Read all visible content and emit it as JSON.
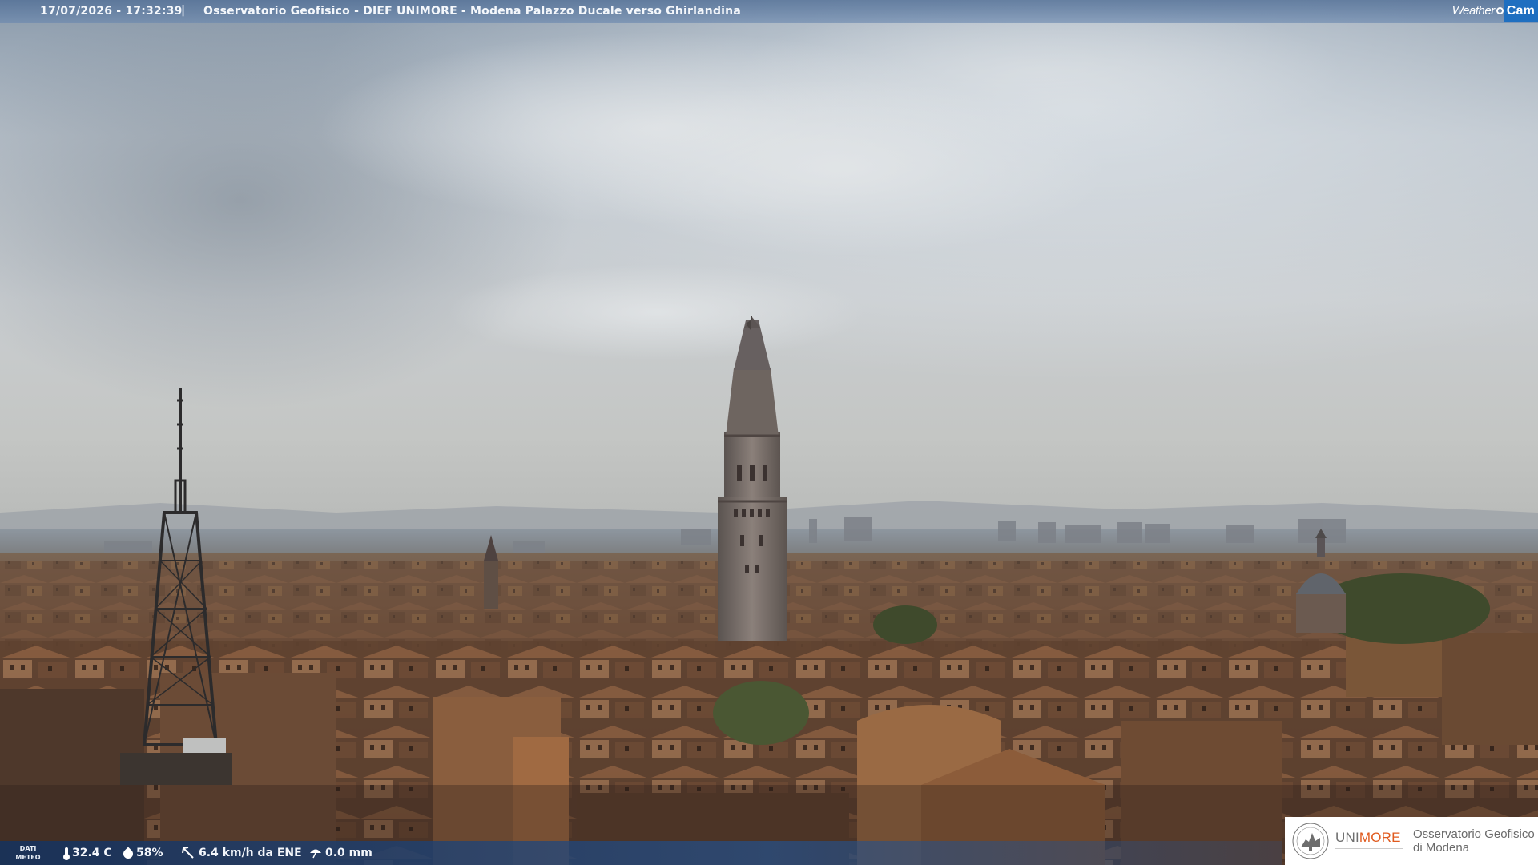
{
  "header": {
    "timestamp": "17/07/2026 - 17:32:39",
    "separator": "|",
    "title": "Osservatorio Geofisico - DIEF UNIMORE - Modena Palazzo Ducale verso Ghirlandina",
    "brand_weather": "Weather",
    "brand_cam": "Cam"
  },
  "weather": {
    "label_line1": "DATI",
    "label_line2": "METEO",
    "temperature": "32.4 C",
    "humidity": "58%",
    "wind": "6.4 km/h da ENE",
    "rain": "0.0 mm"
  },
  "logo": {
    "university": "UNIMORE",
    "university_uni": "UNI",
    "university_more": "MORE",
    "observatory_line1": "Osservatorio Geofisico",
    "observatory_line2": "di Modena"
  },
  "colors": {
    "header_bar": "#5f86b0",
    "bottom_bar": "#1e4a86",
    "brand_cam_bg": "#1f6fc0",
    "unimore_orange": "#e05a1e"
  }
}
